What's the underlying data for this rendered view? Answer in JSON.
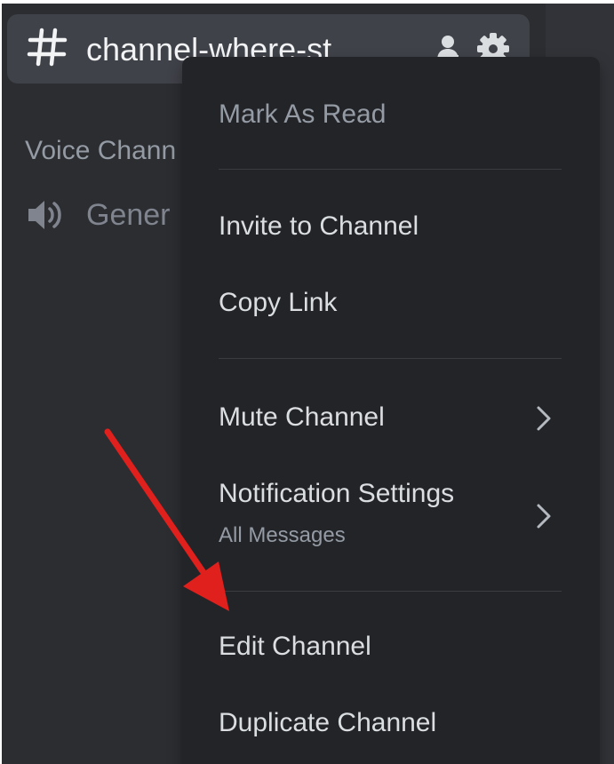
{
  "sidebar": {
    "channel": {
      "name": "channel-where-st",
      "icon": "hash-icon",
      "actions": [
        "member-icon",
        "gear-icon"
      ]
    },
    "category": {
      "label": "Voice Chann"
    },
    "voice_channel": {
      "name": "Gener",
      "icon": "speaker-icon"
    }
  },
  "context_menu": {
    "mark_as_read": "Mark As Read",
    "invite_to_channel": "Invite to Channel",
    "copy_link": "Copy Link",
    "mute_channel": "Mute Channel",
    "notification_settings": "Notification Settings",
    "notification_settings_value": "All Messages",
    "edit_channel": "Edit Channel",
    "duplicate_channel": "Duplicate Channel"
  },
  "colors": {
    "sidebar_bg": "#2b2d31",
    "menu_bg": "#232428",
    "selected_row": "#404249",
    "annotation_arrow": "#e0201c"
  }
}
